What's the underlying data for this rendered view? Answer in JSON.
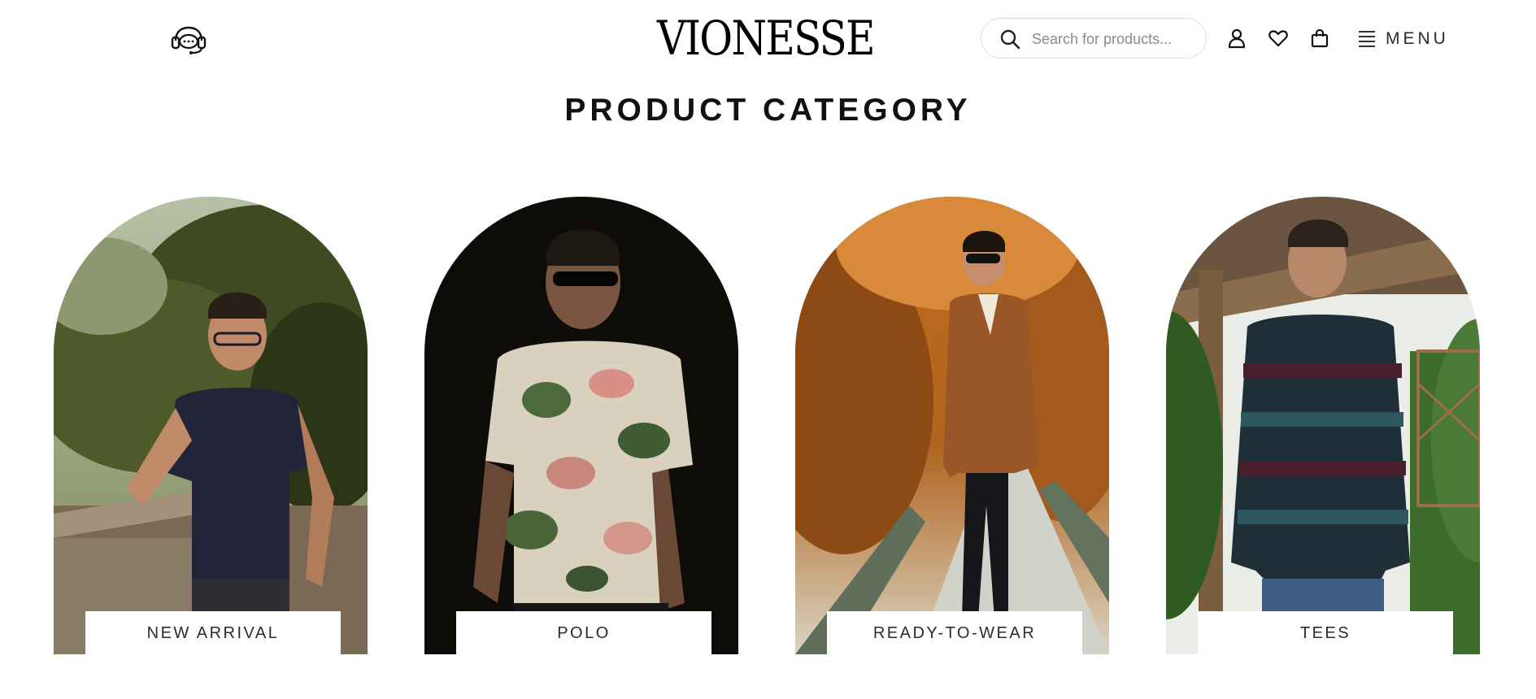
{
  "brand": {
    "logo_text": "VIONESSE"
  },
  "header": {
    "search": {
      "placeholder": "Search for products..."
    },
    "menu_label": "MENU",
    "icons": [
      "support-headset-icon",
      "search-icon",
      "user-icon",
      "heart-icon",
      "shopping-bag-icon",
      "hamburger-menu-icon"
    ]
  },
  "section": {
    "title": "PRODUCT CATEGORY"
  },
  "categories": [
    {
      "label": "NEW ARRIVAL"
    },
    {
      "label": "POLO"
    },
    {
      "label": "READY-TO-WEAR"
    },
    {
      "label": "TEES"
    }
  ],
  "colors": {
    "background": "#ffffff",
    "text": "#111111",
    "label_text": "#2b2b2b",
    "search_border": "#dcdcdc"
  }
}
